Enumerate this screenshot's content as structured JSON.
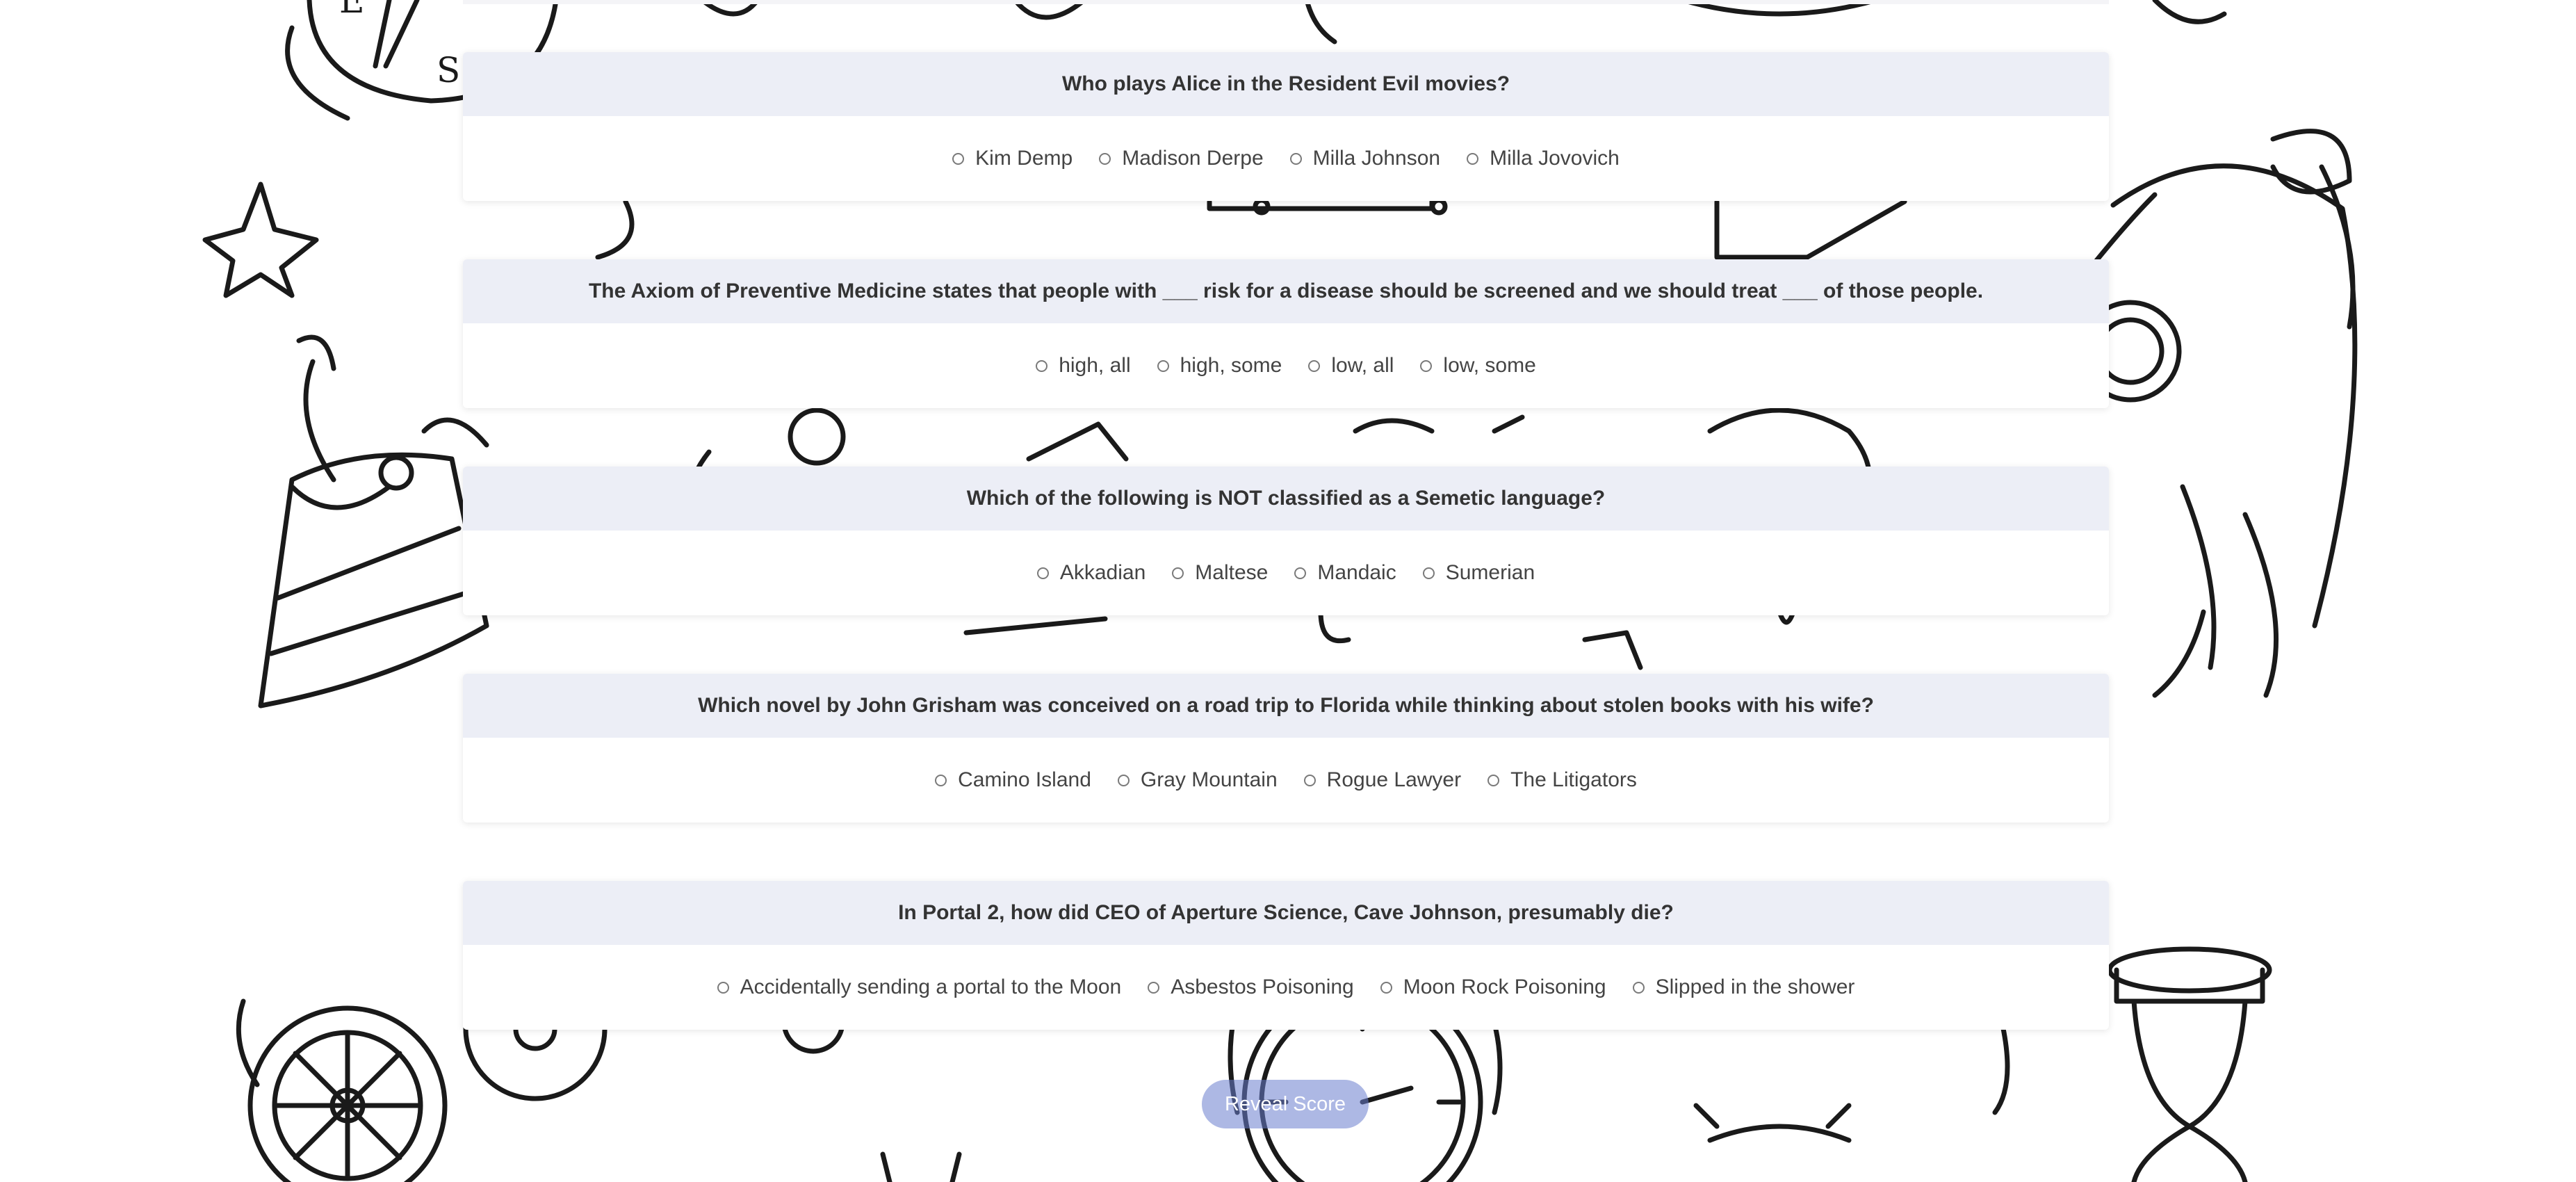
{
  "questions": [
    {
      "text": "Who plays Alice in the Resident Evil movies?",
      "options": [
        "Kim Demp",
        "Madison Derpe",
        "Milla Johnson",
        "Milla Jovovich"
      ]
    },
    {
      "text": "The Axiom of Preventive Medicine states that people with ___ risk for a disease should be screened and we should treat ___ of those people.",
      "options": [
        "high, all",
        "high, some",
        "low, all",
        "low, some"
      ]
    },
    {
      "text": "Which of the following is NOT classified as a Semetic language?",
      "options": [
        "Akkadian",
        "Maltese",
        "Mandaic",
        "Sumerian"
      ]
    },
    {
      "text": "Which novel by John Grisham was conceived on a road trip to Florida while thinking about stolen books with his wife?",
      "options": [
        "Camino Island",
        "Gray Mountain",
        "Rogue Lawyer",
        "The Litigators"
      ]
    },
    {
      "text": "In Portal 2, how did CEO of Aperture Science, Cave Johnson, presumably die?",
      "options": [
        "Accidentally sending a portal to the Moon",
        "Asbestos Poisoning",
        "Moon Rock Poisoning",
        "Slipped in the shower"
      ]
    }
  ],
  "reveal_label": "Reveal Score",
  "compass_letters": [
    "E",
    "S"
  ],
  "colors": {
    "header_bg": "#eceef6",
    "button": "#6a7dcd"
  }
}
